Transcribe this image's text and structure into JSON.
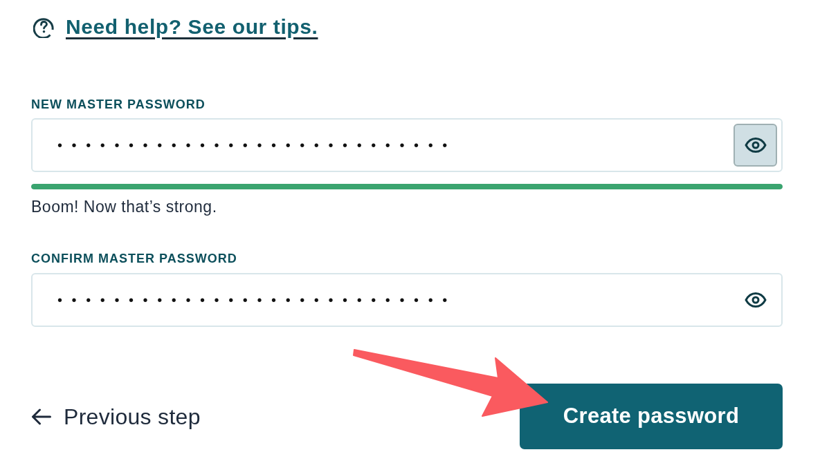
{
  "help_link": {
    "text": "Need help? See our tips."
  },
  "new_password": {
    "label": "NEW MASTER PASSWORD",
    "value": "••••••••••••••••••••••••••••",
    "reveal_button": {
      "highlighted": true
    },
    "strength": {
      "level": 1,
      "message": "Boom! Now that’s strong."
    }
  },
  "confirm_password": {
    "label": "CONFIRM MASTER PASSWORD",
    "value": "••••••••••••••••••••••••••••",
    "reveal_button": {
      "highlighted": false
    }
  },
  "footer": {
    "back_link": "Previous step",
    "primary_button": "Create password"
  }
}
